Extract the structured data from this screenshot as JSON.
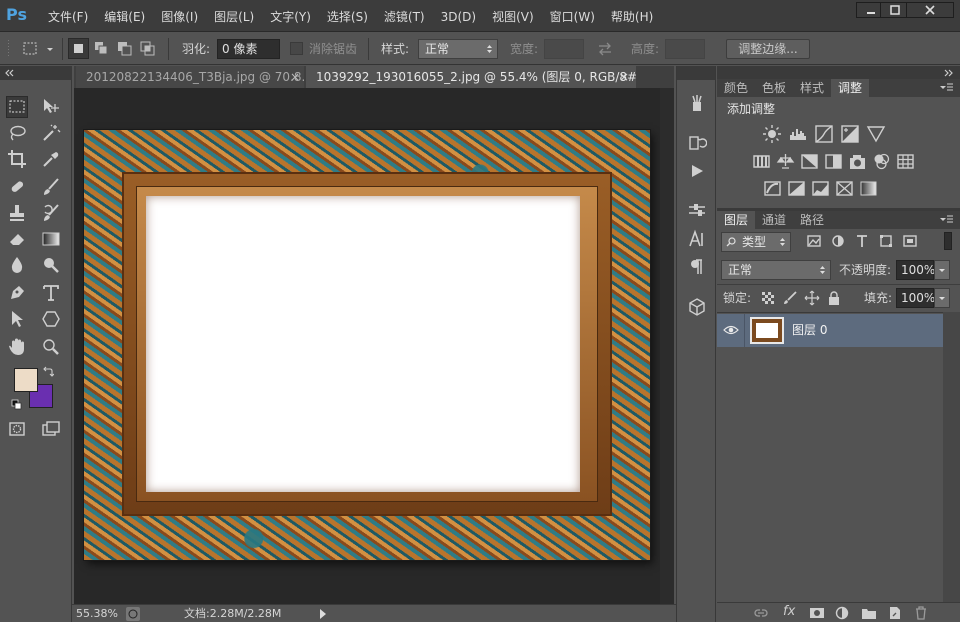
{
  "app": {
    "logo": "Ps"
  },
  "menu": [
    "文件(F)",
    "编辑(E)",
    "图像(I)",
    "图层(L)",
    "文字(Y)",
    "选择(S)",
    "滤镜(T)",
    "3D(D)",
    "视图(V)",
    "窗口(W)",
    "帮助(H)"
  ],
  "window_controls": {
    "minimize": "▁",
    "maximize": "□",
    "close": "✕"
  },
  "options": {
    "feather_label": "羽化:",
    "feather_value": "0 像素",
    "antialias_label": "消除锯齿",
    "style_label": "样式:",
    "style_value": "正常",
    "width_label": "宽度:",
    "height_label": "高度:",
    "refine_edge_button": "调整边缘..."
  },
  "document_tabs": [
    {
      "title": "20120822134406_T3Bja.jpg @ 70.8...",
      "close": "×",
      "active": false
    },
    {
      "title": "1039292_193016055_2.jpg @ 55.4% (图层 0, RGB/8#) *",
      "close": "×",
      "active": true
    }
  ],
  "status": {
    "zoom": "55.38%",
    "doc_info": "文档:2.28M/2.28M"
  },
  "colors": {
    "foreground": "#eddcc7",
    "background": "#6a2fb0",
    "accent": "#4fa3e0"
  },
  "adjustments_panel": {
    "tabs": [
      "颜色",
      "色板",
      "样式",
      "调整"
    ],
    "active_tab": "调整",
    "title": "添加调整",
    "icons_row1": [
      "brightness-icon",
      "levels-icon",
      "curves-icon",
      "exposure-icon",
      "gradient-triangle-icon"
    ],
    "icons_row2": [
      "vibrance-icon",
      "hue-saturation-icon",
      "color-balance-icon",
      "black-white-icon",
      "photo-filter-icon",
      "channel-mixer-icon",
      "color-lookup-icon"
    ],
    "icons_row3": [
      "invert-icon",
      "posterize-icon",
      "threshold-icon",
      "selective-color-icon",
      "gradient-map-icon"
    ]
  },
  "layers_panel": {
    "tabs": [
      "图层",
      "通道",
      "路径"
    ],
    "active_tab": "图层",
    "filter_label": "类型",
    "blend_mode": "正常",
    "opacity_label": "不透明度:",
    "opacity_value": "100%",
    "lock_label": "锁定:",
    "fill_label": "填充:",
    "fill_value": "100%",
    "layers": [
      {
        "name": "图层 0",
        "visible": true,
        "selected": true
      }
    ],
    "footer_fx": "fx"
  }
}
